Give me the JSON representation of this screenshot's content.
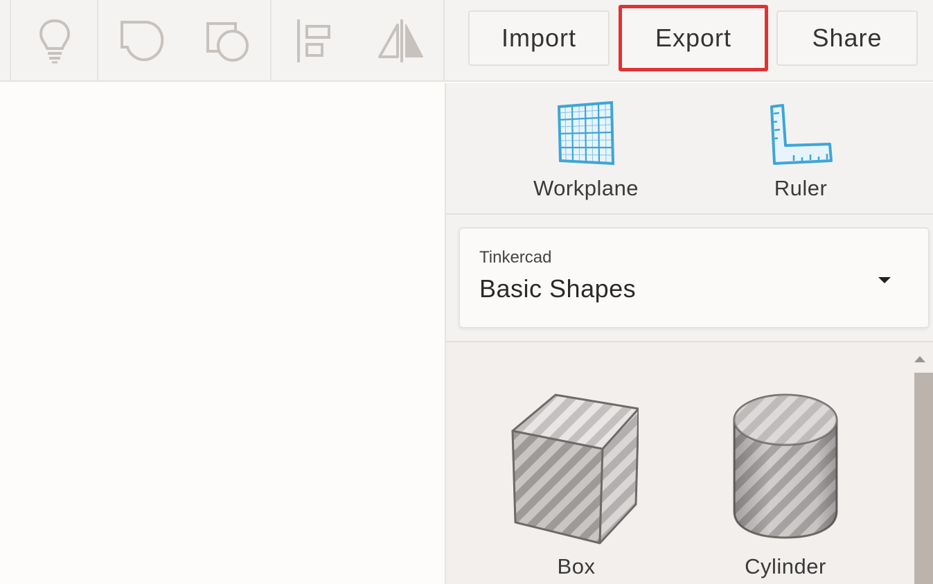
{
  "toolbar": {
    "icons": [
      {
        "name": "lightbulb-icon"
      },
      {
        "name": "group-shape-icon"
      },
      {
        "name": "ungroup-shape-icon"
      },
      {
        "name": "align-icon"
      },
      {
        "name": "mirror-icon"
      }
    ],
    "import_label": "Import",
    "export_label": "Export",
    "share_label": "Share",
    "highlight_color": "#e03232"
  },
  "helpers": {
    "workplane_label": "Workplane",
    "ruler_label": "Ruler",
    "icon_color": "#3ea5d8"
  },
  "library": {
    "provider": "Tinkercad",
    "selected": "Basic Shapes"
  },
  "shapes": [
    {
      "label": "Box",
      "icon": "box-shape-icon"
    },
    {
      "label": "Cylinder",
      "icon": "cylinder-shape-icon"
    }
  ]
}
